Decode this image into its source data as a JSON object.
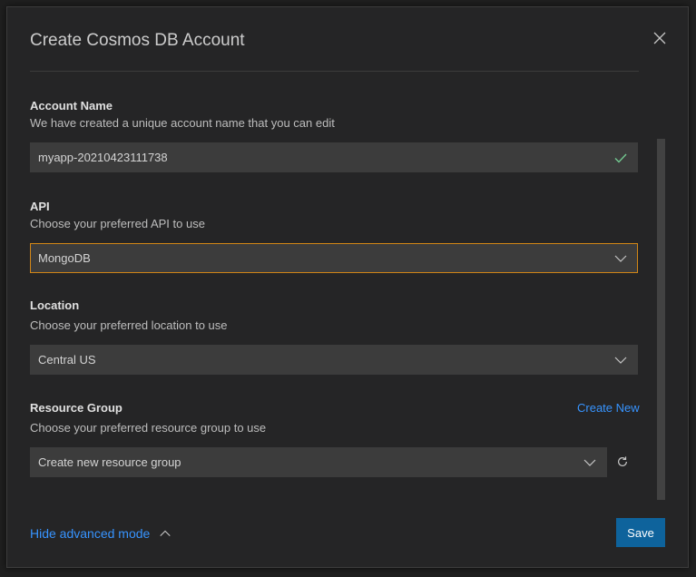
{
  "dialog": {
    "title": "Create Cosmos DB Account"
  },
  "account_name": {
    "label": "Account Name",
    "description": "We have created a unique account name that you can edit",
    "value": "myapp-20210423111738",
    "status_icon": "check-icon"
  },
  "api": {
    "label": "API",
    "description": "Choose your preferred API to use",
    "selected": "MongoDB"
  },
  "location": {
    "label": "Location",
    "description": "Choose your preferred location to use",
    "selected": "Central US"
  },
  "resource_group": {
    "label": "Resource Group",
    "description": "Choose your preferred resource group to use",
    "selected": "Create new resource group",
    "create_new_label": "Create New"
  },
  "footer": {
    "advanced_toggle_label": "Hide advanced mode",
    "save_label": "Save"
  },
  "colors": {
    "accent_focus": "#d18616",
    "link": "#3794ff",
    "primary_button": "#0e639c",
    "valid_check": "#73c991"
  }
}
